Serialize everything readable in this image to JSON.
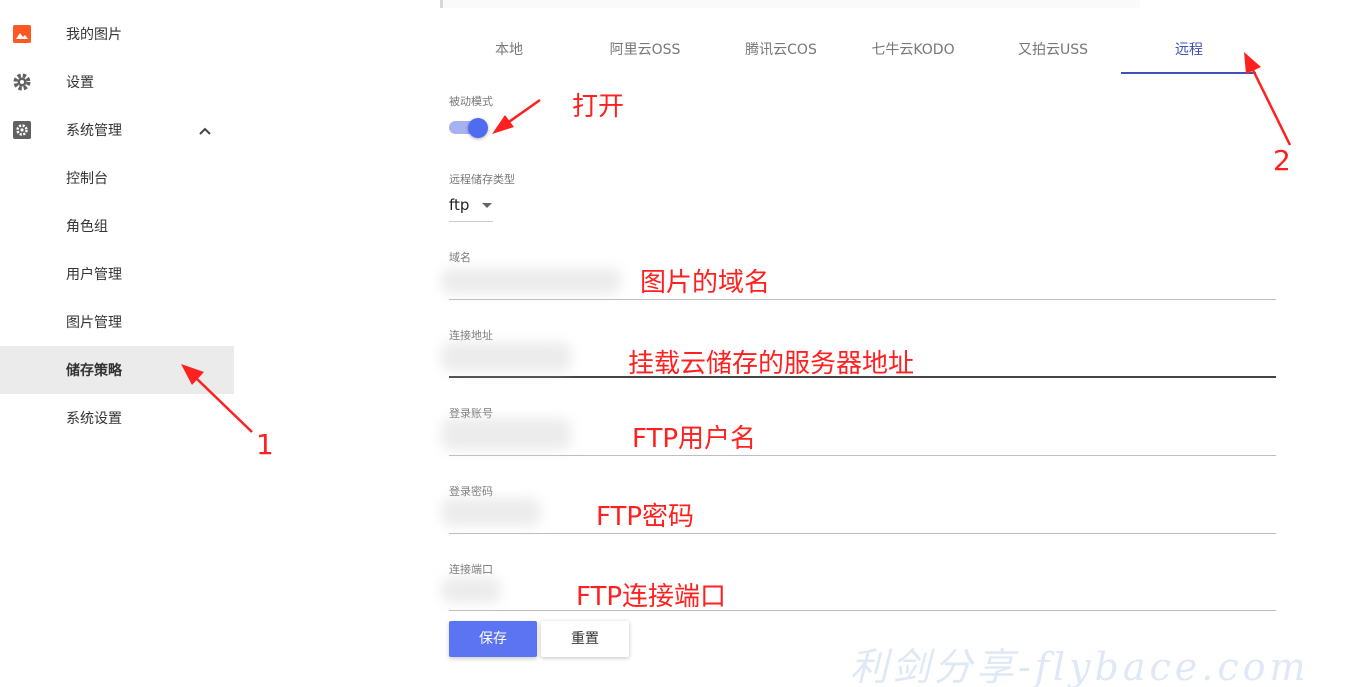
{
  "sidebar": {
    "items": [
      {
        "label": "我的图片",
        "icon": "image-icon"
      },
      {
        "label": "设置",
        "icon": "gear-icon"
      },
      {
        "label": "系统管理",
        "icon": "settings-box-icon"
      },
      {
        "label": "控制台"
      },
      {
        "label": "角色组"
      },
      {
        "label": "用户管理"
      },
      {
        "label": "图片管理"
      },
      {
        "label": "储存策略",
        "active": true
      },
      {
        "label": "系统设置"
      }
    ]
  },
  "tabs": [
    "本地",
    "阿里云OSS",
    "腾讯云COS",
    "七牛云KODO",
    "又拍云USS",
    "远程"
  ],
  "active_tab": "远程",
  "form": {
    "passive_mode_label": "被动模式",
    "passive_mode_on": true,
    "storage_type_label": "远程储存类型",
    "storage_type_value": "ftp",
    "domain_label": "域名",
    "host_label": "连接地址",
    "account_label": "登录账号",
    "password_label": "登录密码",
    "port_label": "连接端口",
    "save_label": "保存",
    "reset_label": "重置"
  },
  "annotations": {
    "toggle": "打开",
    "domain": "图片的域名",
    "host": "挂载云储存的服务器地址",
    "account": "FTP用户名",
    "password": "FTP密码",
    "port": "FTP连接端口",
    "marker1": "1",
    "marker2": "2"
  },
  "watermark": "利剑分享-flybace.com",
  "colors": {
    "accent": "#3f51b5",
    "primary_button": "#5c73f2",
    "annotation": "#ff2020",
    "sidebar_active_bg": "#ebebeb"
  }
}
